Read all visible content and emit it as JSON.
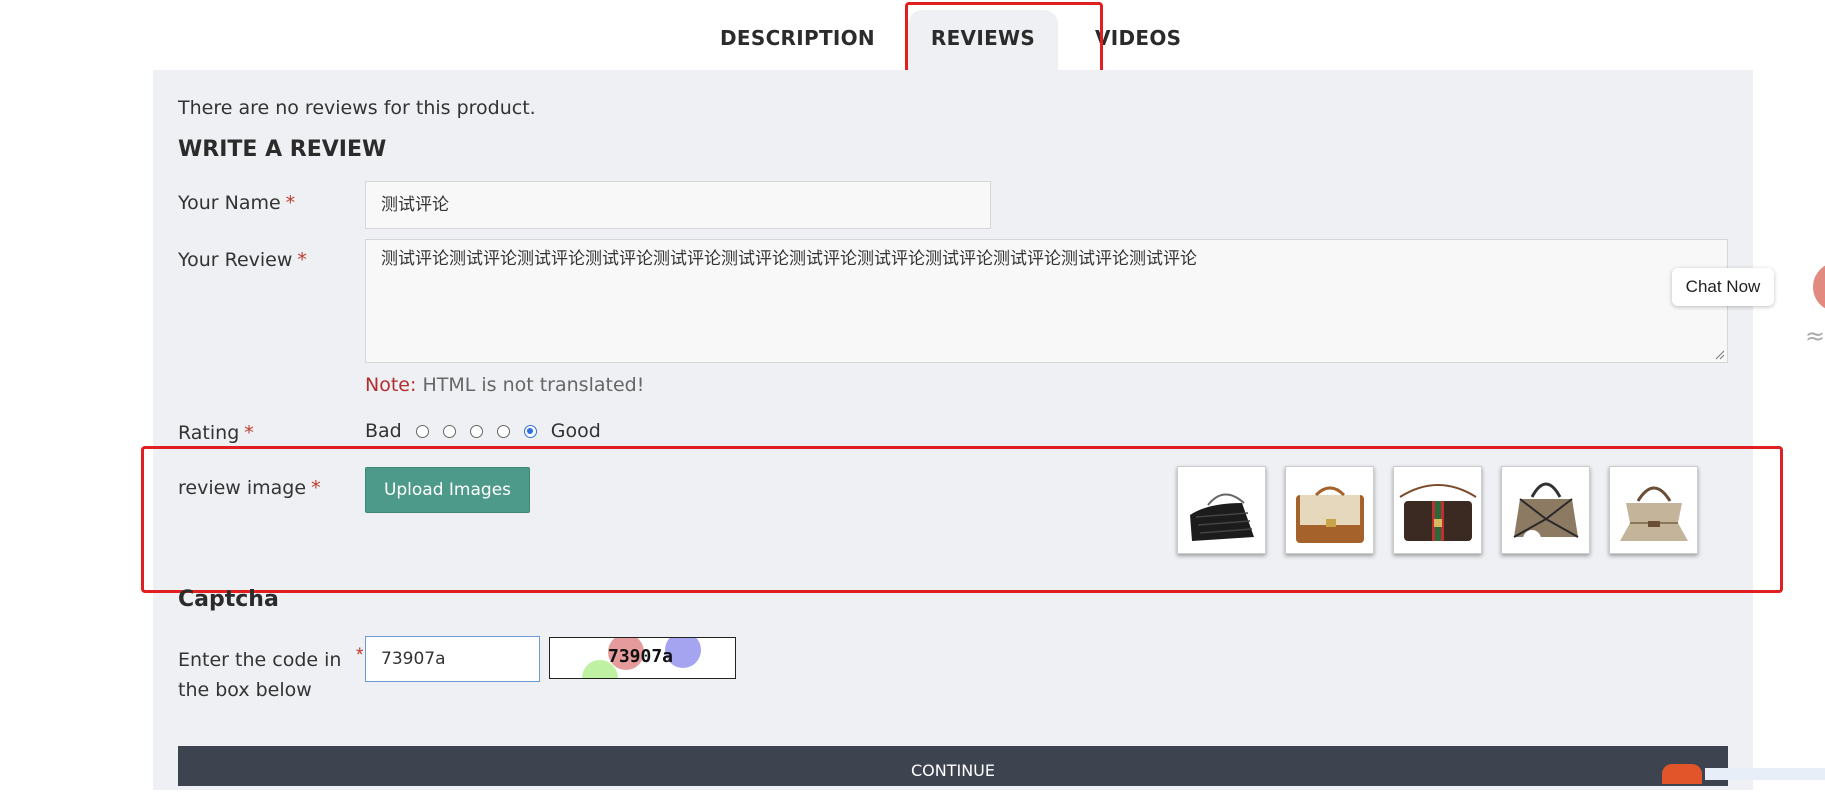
{
  "tabs": {
    "description": "DESCRIPTION",
    "reviews": "REVIEWS",
    "videos": "VIDEOS"
  },
  "reviews": {
    "empty_message": "There are no reviews for this product.",
    "write_heading": "WRITE A REVIEW"
  },
  "form": {
    "required_mark": "*",
    "name_label": "Your Name",
    "name_value": "测试评论",
    "review_label": "Your Review",
    "review_value": "测试评论测试评论测试评论测试评论测试评论测试评论测试评论测试评论测试评论测试评论测试评论测试评论",
    "note_label": "Note:",
    "note_text": "HTML is not translated!",
    "rating_label": "Rating",
    "rating_bad": "Bad",
    "rating_good": "Good",
    "rating_selected": 5,
    "rating_max": 5,
    "image_label": "review image",
    "upload_button": "Upload Images",
    "thumbnails": [
      "black-quilted-chain-bag",
      "beige-tan-flap-bag",
      "striped-crossbody-bag",
      "geometric-top-handle-bag",
      "monogram-hourglass-bag"
    ]
  },
  "captcha": {
    "heading": "Captcha",
    "code_label": "Enter the code in the box below",
    "code_value": "73907a",
    "image_text": "73907a"
  },
  "actions": {
    "continue_button": "CONTINUE"
  },
  "chat": {
    "bubble_text": "Chat Now"
  },
  "colors": {
    "annotation": "#e02020",
    "upload_button": "#4e9a8a",
    "continue_button": "#3d434f",
    "required": "#c0392b"
  }
}
